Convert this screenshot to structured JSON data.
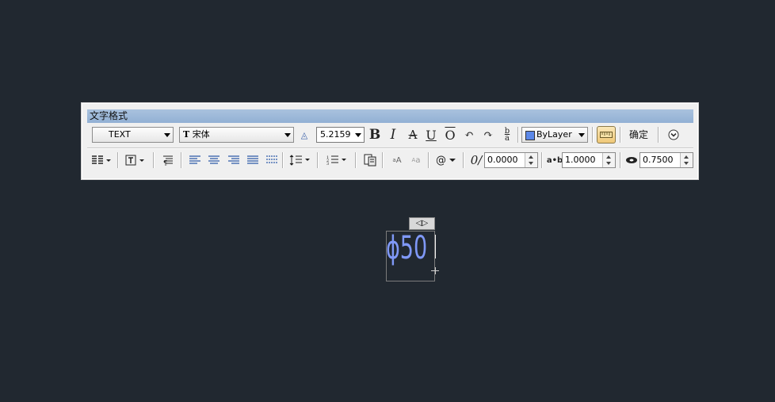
{
  "dialog": {
    "title": "文字格式"
  },
  "row1": {
    "style_value": "TEXT",
    "font_value": "宋体",
    "font_prefix": "T",
    "height_value": "5.2159",
    "bold": "B",
    "italic": "I",
    "strike": "A",
    "underline": "U",
    "overline": "O",
    "stack_top": "b",
    "stack_bottom": "a",
    "color_value": "ByLayer",
    "color_swatch": "#5c88e8",
    "ok_label": "确定"
  },
  "row2": {
    "oblique_value": "0.0000",
    "tracking_value": "1.0000",
    "width_value": "0.7500",
    "tracking_icon_text": "a•b",
    "insert_symbol": "@"
  },
  "canvas": {
    "mtext": "ϕ50",
    "resize_tab": "◁▷"
  },
  "colors": {
    "background": "#212830",
    "text_entity": "#7f98f6",
    "title_bar": "#9db8da"
  }
}
